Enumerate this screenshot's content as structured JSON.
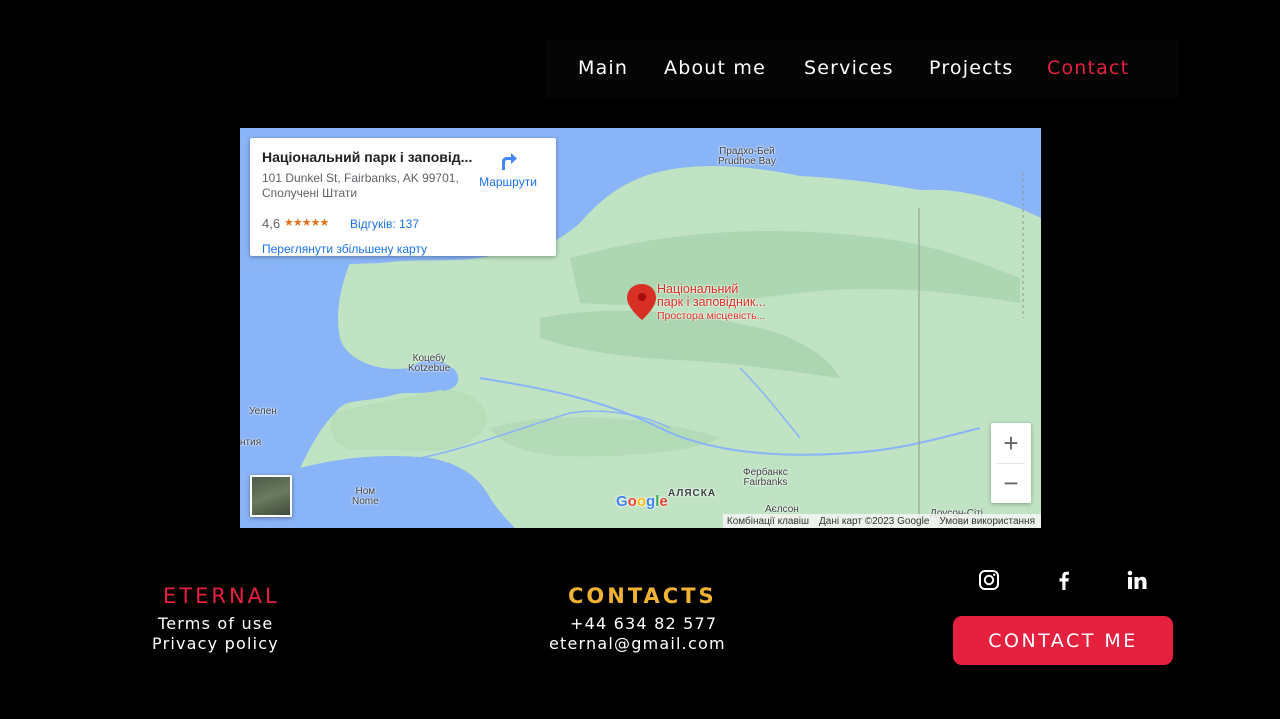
{
  "nav": {
    "items": [
      {
        "label": "Main"
      },
      {
        "label": "About me"
      },
      {
        "label": "Services"
      },
      {
        "label": "Projects"
      },
      {
        "label": "Contact"
      }
    ],
    "active": "Contact"
  },
  "map": {
    "card": {
      "title": "Національний парк і заповід...",
      "address": "101 Dunkel St, Fairbanks, AK 99701, Сполучені Штати",
      "rating": "4,6",
      "stars": "★★★★★",
      "reviews": "Відгуків: 137",
      "directions": "Маршрути",
      "view_larger": "Переглянути збільшену карту"
    },
    "pin": {
      "line1": "Національний",
      "line2": "парк і заповідник...",
      "line3": "Простора місцевість..."
    },
    "places": {
      "prudhoe_ua": "Прадхо-Бей",
      "prudhoe_en": "Prudhoe Bay",
      "kotzebue_ua": "Коцебу",
      "kotzebue_en": "Kotzebue",
      "nome_ua": "Ном",
      "nome_en": "Nome",
      "fairbanks_ua": "Фербанкс",
      "fairbanks_en": "Fairbanks",
      "alaska": "АЛЯСКА",
      "eielson": "Аєлсон",
      "welen": "Уелен",
      "chukotka": "нтия",
      "dawson": "Доусон-Сіті"
    },
    "zoom_in": "+",
    "zoom_out": "−",
    "google": "Google",
    "attribution": {
      "shortcuts": "Комбінації клавіш",
      "data": "Дані карт ©2023 Google",
      "terms": "Умови використання"
    },
    "colors": {
      "land": "#bfe3c3",
      "water": "#8ab4f8",
      "pin": "#d93025"
    }
  },
  "footer": {
    "brand": "ETERNAL",
    "terms": "Terms of use",
    "privacy": "Privacy policy",
    "contacts_heading": "CONTACTS",
    "phone": "+44 634 82 577",
    "email": "eternal@gmail.com",
    "cta": "CONTACT ME",
    "social": [
      "instagram-icon",
      "facebook-icon",
      "linkedin-icon"
    ]
  },
  "colors": {
    "accent": "#e6203f",
    "gold": "#f2b233",
    "background": "#000000"
  }
}
